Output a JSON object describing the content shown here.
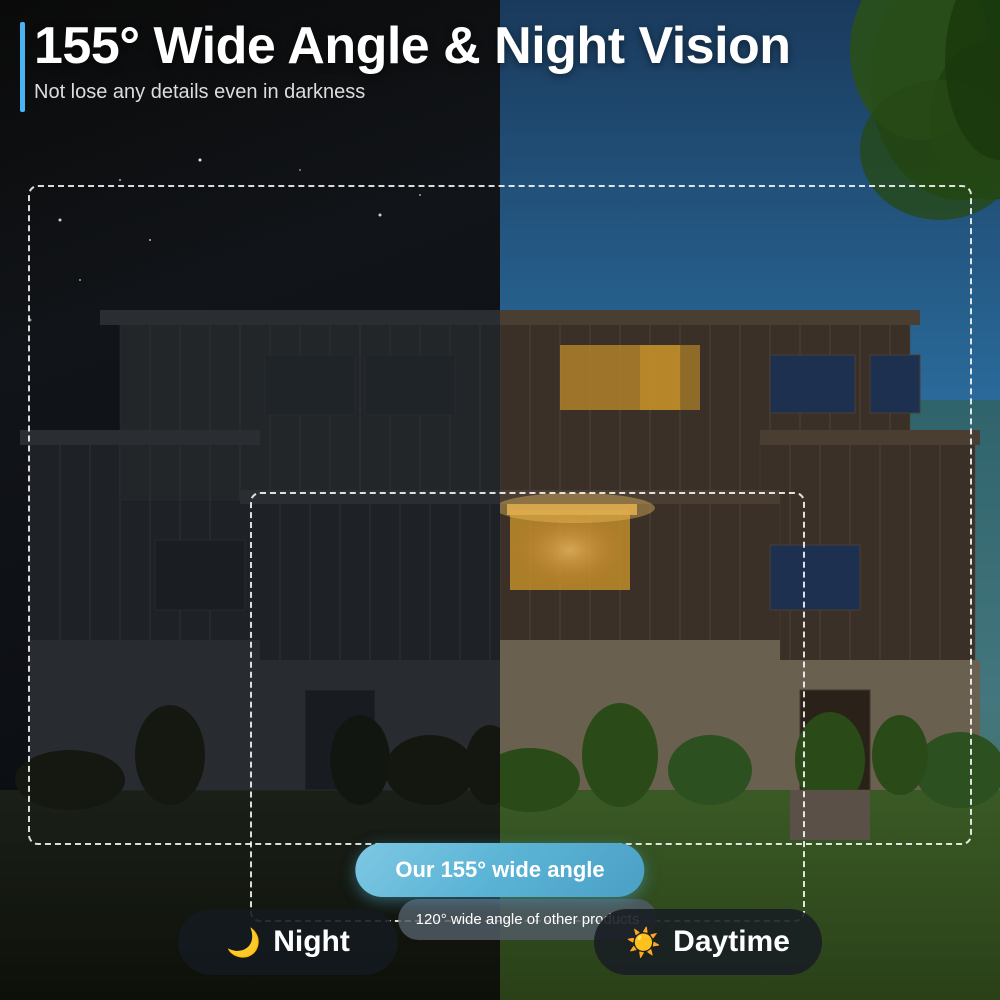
{
  "header": {
    "title": "155° Wide Angle & Night Vision",
    "subtitle": "Not lose any details even in darkness"
  },
  "labels": {
    "inner_label": "120° wide angle of\nother products",
    "outer_label": "Our 155° wide angle"
  },
  "mode_buttons": {
    "night": {
      "icon": "🌙",
      "label": "Night"
    },
    "day": {
      "icon": "☀️",
      "label": "Daytime"
    }
  },
  "colors": {
    "accent": "#4ab3f4",
    "text_primary": "#ffffff",
    "text_secondary": "#dddddd",
    "badge_blue": "#5ab3d5",
    "badge_dark": "rgba(20,25,30,0.9)"
  }
}
